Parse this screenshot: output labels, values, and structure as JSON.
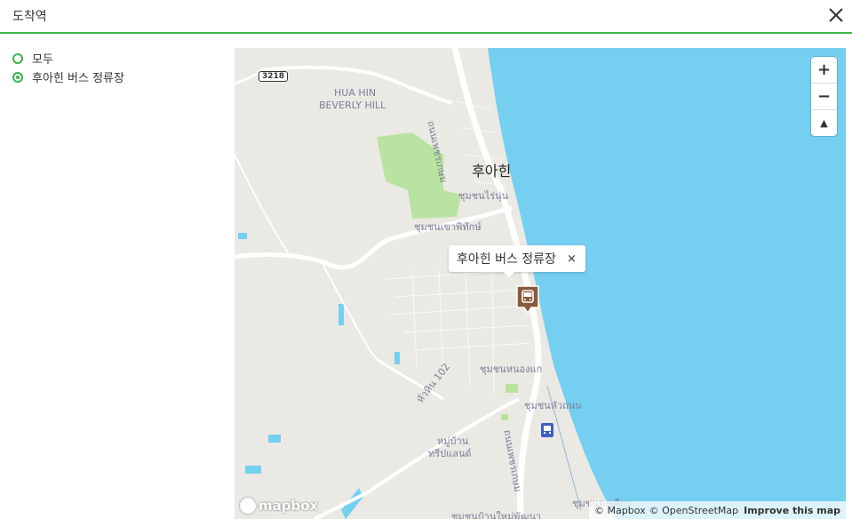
{
  "header": {
    "title": "도착역"
  },
  "options": [
    {
      "label": "모두",
      "checked": false
    },
    {
      "label": "후아힌 버스 정류장",
      "checked": true
    }
  ],
  "map": {
    "road_shield": "3218",
    "labels": {
      "district_1": "HUA HIN",
      "district_2": "BEVERLY HILL",
      "city": "후아힌",
      "road_main": "ถนนเพชรเกษม",
      "area_1": "ชุมชนไร่นุ่น",
      "area_2": "ชุมชนเขาพิทักษ์",
      "area_3": "ชุมชนหนองแก",
      "area_4": "ชุมชนหัวถนน",
      "area_5a": "หมู่บ้าน",
      "area_5b": "ทรีปแลนด์",
      "road_102": "หัวหิน 102",
      "road_main_2": "ถนนเพชรเกษม",
      "area_6": "ชุมชนตะเคียน",
      "area_7": "ชุมชนบ้านใหม่พัฒนา"
    },
    "popup": {
      "text": "후아힌 버스 정류장",
      "close": "×"
    },
    "zoom": {
      "in": "+",
      "out": "−",
      "compass": "▲"
    },
    "attribution": {
      "mapbox": "© Mapbox",
      "osm": "© OpenStreetMap",
      "improve": "Improve this map"
    },
    "logo": "mapbox",
    "colors": {
      "water": "#75cff0",
      "land": "#ebe9e4",
      "park": "#b9e3a0",
      "marker": "#8b5a3c",
      "accent": "#3cb54a"
    }
  }
}
